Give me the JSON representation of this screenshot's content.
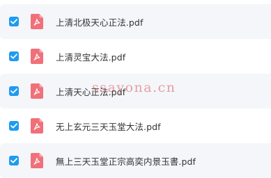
{
  "icons": {
    "checkbox": "checkbox-checked-icon",
    "file": "pdf-file-icon"
  },
  "colors": {
    "checkbox": "#1f9bf0",
    "pdf_icon": "#f0707a",
    "row_tint": "#f4f6fa"
  },
  "files": [
    {
      "name": "上清北极天心正法.pdf",
      "checked": true
    },
    {
      "name": "上清灵宝大法.pdf",
      "checked": true
    },
    {
      "name": "上清天心正法.pdf",
      "checked": true
    },
    {
      "name": "无上玄元三天玉堂大法.pdf",
      "checked": true
    },
    {
      "name": "無上三天玉堂正宗高奕内景玉書.pdf",
      "checked": true
    }
  ],
  "watermark": "ssayona.cn"
}
